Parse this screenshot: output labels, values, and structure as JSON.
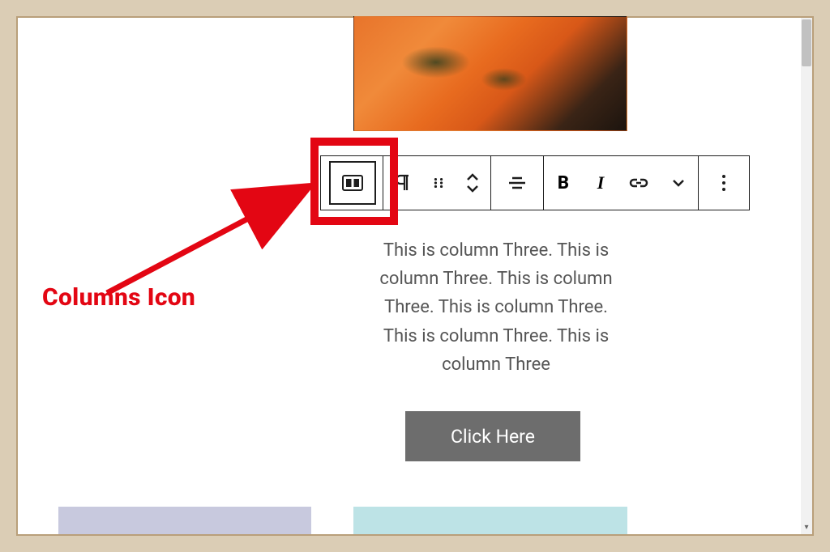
{
  "annotation": {
    "label": "Columns Icon"
  },
  "toolbar": {
    "columns": "columns",
    "paragraph": "paragraph",
    "drag": "drag",
    "move": "move up/down",
    "align": "align",
    "bold": "B",
    "italic": "I",
    "link": "link",
    "more_inline": "more",
    "options": "options"
  },
  "content": {
    "column_text": "This is column Three. This is column Three. This is column Three. This is column Three. This is column Three. This is column Three",
    "button_label": "Click Here"
  },
  "image": {
    "alt": "salmon with herbs"
  },
  "colors": {
    "accent_red": "#e30613",
    "button_bg": "#6d6d6d",
    "block_a": "#c8c9de",
    "block_b": "#bde3e6",
    "frame_bg": "#dbcdb5"
  }
}
